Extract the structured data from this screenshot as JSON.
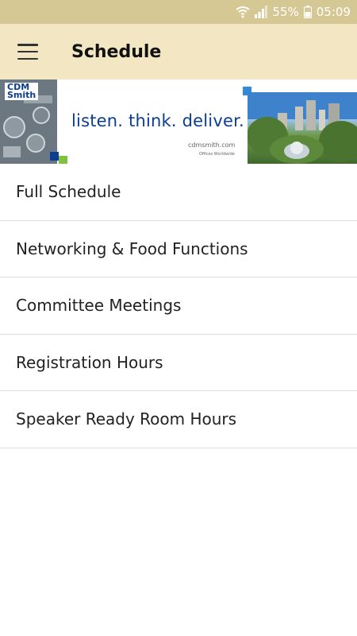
{
  "status_bar": {
    "battery_percent": "55%",
    "time": "05:09",
    "icons": [
      "wifi-icon",
      "signal-icon",
      "battery-icon"
    ]
  },
  "app_bar": {
    "title": "Schedule",
    "menu_icon": "menu-icon"
  },
  "banner": {
    "logo_text": [
      "CDM",
      "Smith"
    ],
    "tagline": "listen. think. deliver.",
    "website": "cdmsmith.com",
    "subtext": "Offices Worldwide"
  },
  "menu": {
    "items": [
      {
        "label": "Full Schedule"
      },
      {
        "label": "Networking & Food Functions"
      },
      {
        "label": "Committee Meetings"
      },
      {
        "label": "Registration Hours"
      },
      {
        "label": "Speaker Ready Room Hours"
      }
    ]
  },
  "colors": {
    "status_bar": "#d6c894",
    "app_bar": "#f2e6c3",
    "brand_blue": "#0b3d91"
  }
}
